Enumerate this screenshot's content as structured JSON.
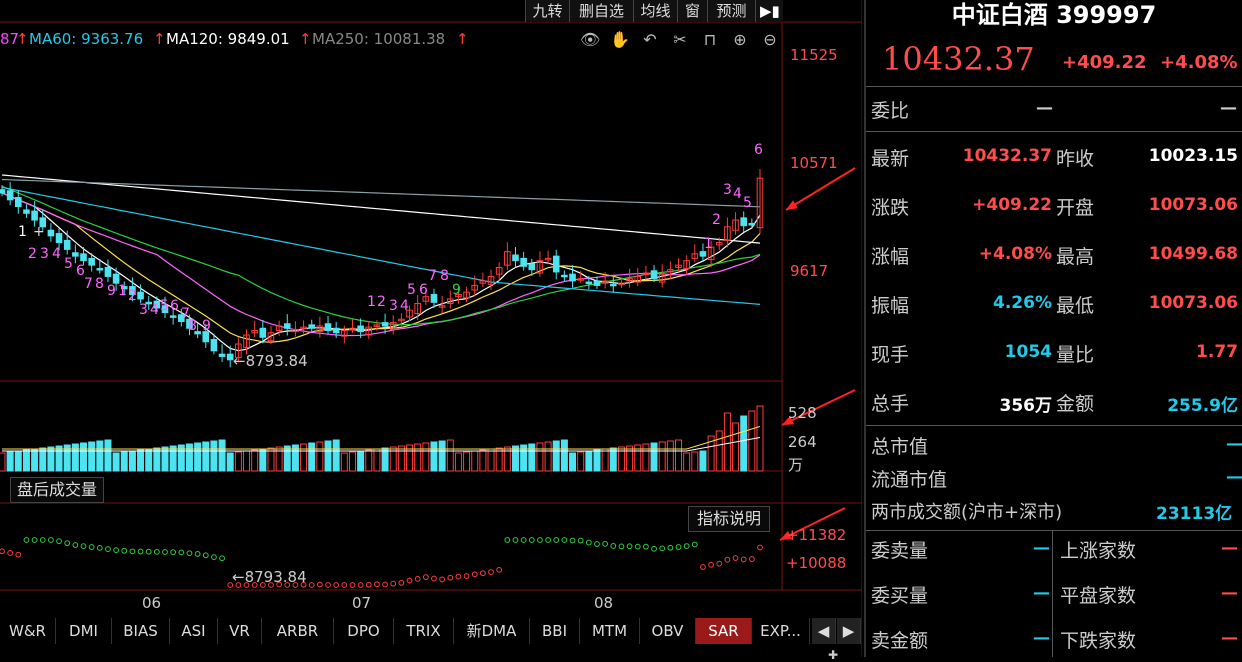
{
  "toolbar": {
    "buttons": [
      "九转",
      "删自选",
      "均线",
      "窗",
      "预测"
    ]
  },
  "ma_legend": [
    {
      "text": "87",
      "color": "#ff44ff"
    },
    {
      "text": "MA60: 9363.76",
      "color": "#25c8e8"
    },
    {
      "text": "MA120: 9849.01",
      "color": "#ffffff"
    },
    {
      "text": "MA250: 10081.38",
      "color": "#888888"
    }
  ],
  "price_axis": [
    "11525",
    "10571",
    "9617"
  ],
  "vol_axis": [
    "528",
    "264",
    "万"
  ],
  "sar_axis": [
    "+11382",
    "+10088"
  ],
  "low_marker": "8793.84",
  "sar_low_marker": "8793.84",
  "months": [
    "06",
    "07",
    "08"
  ],
  "after_hours_label": "盘后成交量",
  "indicator_desc_label": "指标说明",
  "nine_turn_labels": {
    "green_1": "1",
    "a": "2",
    "b": "3",
    "c": "4",
    "d": "5",
    "e": "6",
    "f": "7",
    "g": "8",
    "h": "9",
    "down_nums": [
      "1",
      "2",
      "3",
      "4",
      "5",
      "6",
      "7",
      "8",
      "9",
      "1",
      "2",
      "3",
      "4",
      "5",
      "6",
      "7",
      "8",
      "9"
    ],
    "up_nums": [
      "1",
      "2",
      "3",
      "4",
      "5",
      "6",
      "7",
      "8",
      "9",
      "1",
      "2",
      "3",
      "4",
      "5",
      "6"
    ]
  },
  "tabs": [
    "W&R",
    "DMI",
    "BIAS",
    "ASI",
    "VR",
    "ARBR",
    "DPO",
    "TRIX",
    "新DMA",
    "BBI",
    "MTM",
    "OBV",
    "SAR",
    "EXP..."
  ],
  "active_tab": "SAR",
  "panel": {
    "name": "中证白酒",
    "code": "399997",
    "price": "10432.37",
    "change": "+409.22",
    "change_pct": "+4.08%",
    "weibi_label": "委比",
    "weibi_v1": "—",
    "weibi_v2": "—",
    "rows": [
      {
        "l1": "最新",
        "v1": "10432.37",
        "c1": "red",
        "l2": "昨收",
        "v2": "10023.15",
        "c2": "white"
      },
      {
        "l1": "涨跌",
        "v1": "+409.22",
        "c1": "red",
        "l2": "开盘",
        "v2": "10073.06",
        "c2": "red"
      },
      {
        "l1": "涨幅",
        "v1": "+4.08%",
        "c1": "red",
        "l2": "最高",
        "v2": "10499.68",
        "c2": "red"
      },
      {
        "l1": "振幅",
        "v1": "4.26%",
        "c1": "cyan",
        "l2": "最低",
        "v2": "10073.06",
        "c2": "red"
      },
      {
        "l1": "现手",
        "v1": "1054",
        "c1": "cyan",
        "l2": "量比",
        "v2": "1.77",
        "c2": "red"
      },
      {
        "l1": "总手",
        "v1": "356万",
        "c1": "white",
        "l2": "金额",
        "v2": "255.9亿",
        "c2": "cyan"
      }
    ],
    "total_mv_label": "总市值",
    "total_mv": "—",
    "float_mv_label": "流通市值",
    "float_mv": "—",
    "turnover_label": "两市成交额(沪市+深市)",
    "turnover": "23113亿",
    "bottom_rows": [
      {
        "l1": "委卖量",
        "v1": "—",
        "l2": "上涨家数",
        "v2": "—"
      },
      {
        "l1": "委买量",
        "v1": "—",
        "l2": "平盘家数",
        "v2": "—"
      },
      {
        "l1": "卖金额",
        "v1": "—",
        "l2": "下跌家数",
        "v2": "—"
      }
    ]
  },
  "colors": {
    "up": "#ff3c3c",
    "down": "#4de3f0",
    "ma_white": "#ffffff",
    "ma_yellow": "#ffe14d",
    "ma_magenta": "#ff66ff",
    "ma_green": "#2bcf3e",
    "ma_cyan": "#25c8e8",
    "ma_gray": "#8aa0a8",
    "arrow": "#ff2222"
  }
}
